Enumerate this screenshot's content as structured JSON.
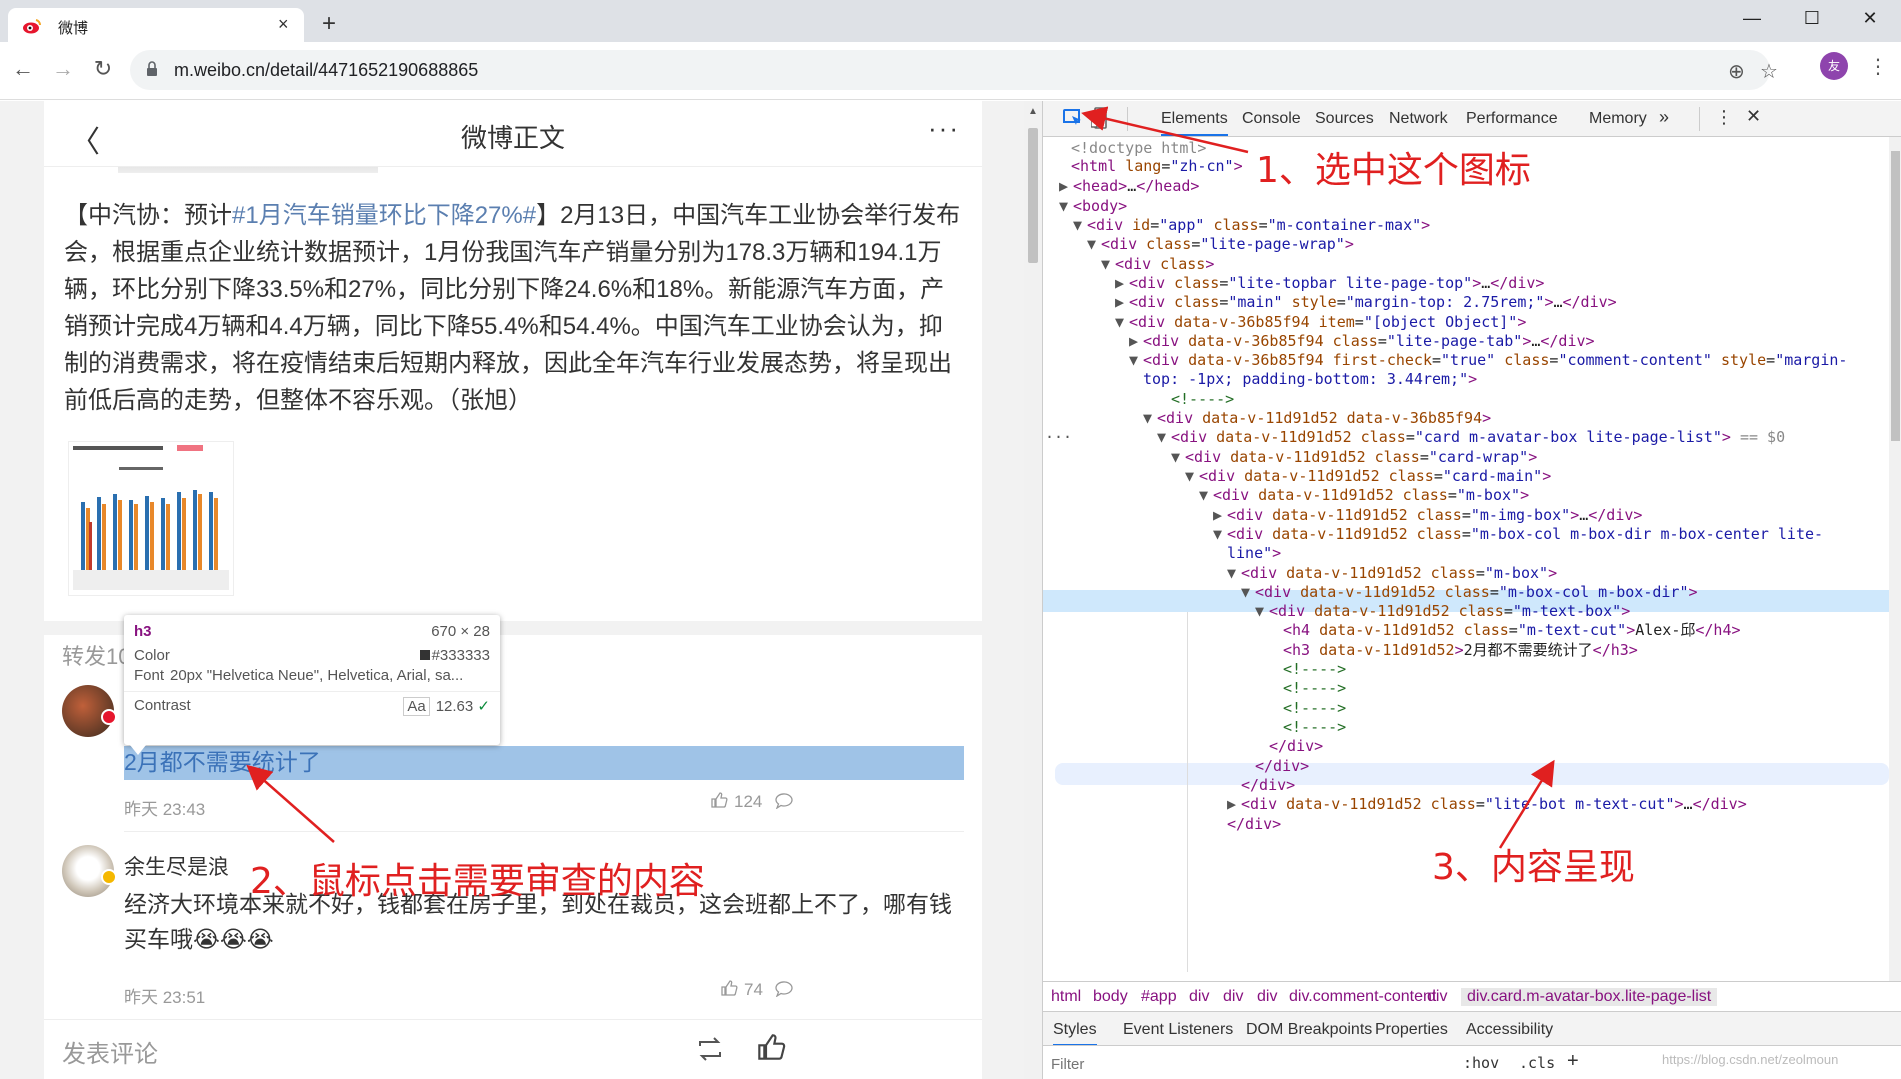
{
  "browser": {
    "tab_title": "微博",
    "tab_close": "×",
    "new_tab": "+",
    "url": "m.weibo.cn/detail/4471652190688865",
    "profile_initial": "友",
    "window_controls": {
      "minimize": "—",
      "maximize": "☐",
      "close": "✕"
    }
  },
  "weibo": {
    "header_title": "微博正文",
    "back_glyph": "〈",
    "more_glyph": "···",
    "post_prefix": "【中汽协：预计",
    "post_tag": "#1月汽车销量环比下降27%#",
    "post_rest": "】2月13日，中国汽车工业协会举行发布会，根据重点企业统计数据预计，1月份我国汽车产销量分别为178.3万辆和194.1万辆，环比分别下降33.5%和27%，同比分别下降24.6%和18%。新能源汽车方面，产销预计完成4万辆和4.4万辆，同比下降55.4%和54.4%。中国汽车工业协会认为，抑制的消费需求，将在疫情结束后短期内释放，因此全年汽车行业发展态势，将呈现出前低后高的走势，但整体不容乐观。（张旭）",
    "repost_label": "转发10",
    "comments": [
      {
        "name": "",
        "text": "2月都不需要统计了",
        "time": "昨天 23:43",
        "likes": "124"
      },
      {
        "name": "余生尽是浪",
        "text": "经济大环境本来就不好，钱都套在房子里，到处在裁员，这会班都上不了，哪有钱买车哦😭😭😭",
        "time": "昨天 23:51",
        "likes": "74"
      }
    ],
    "footer_label": "发表评论"
  },
  "tooltip": {
    "tag": "h3",
    "size": "670 × 28",
    "color_label": "Color",
    "color_value": "#333333",
    "font_label": "Font",
    "font_value": "20px \"Helvetica Neue\", Helvetica, Arial, sa...",
    "contrast_label": "Contrast",
    "contrast_aa": "Aa",
    "contrast_value": "12.63",
    "contrast_ok": "✓"
  },
  "devtools": {
    "tabs": [
      "Elements",
      "Console",
      "Sources",
      "Network",
      "Performance",
      "Memory"
    ],
    "overflow": "»",
    "selected_marker": "== $0",
    "breadcrumbs": [
      "html",
      "body",
      "#app",
      "div",
      "div",
      "div",
      "div.comment-content",
      "div",
      "div.card.m-avatar-box.lite-page-list"
    ],
    "subtabs": [
      "Styles",
      "Event Listeners",
      "DOM Breakpoints",
      "Properties",
      "Accessibility"
    ],
    "filter_placeholder": "Filter",
    "filter_hov": ":hov",
    "filter_cls": ".cls",
    "filter_plus": "+"
  },
  "annotations": {
    "step1": "1、选中这个图标",
    "step2": "2、鼠标点击需要审查的内容",
    "step3": "3、内容呈现"
  },
  "watermark": "https://blog.csdn.net/zeolmoun",
  "colors": {
    "accent": "#1a73e8",
    "annotation": "#e02020",
    "tag": "#881280",
    "attr": "#994500",
    "value": "#1a1aa6"
  }
}
